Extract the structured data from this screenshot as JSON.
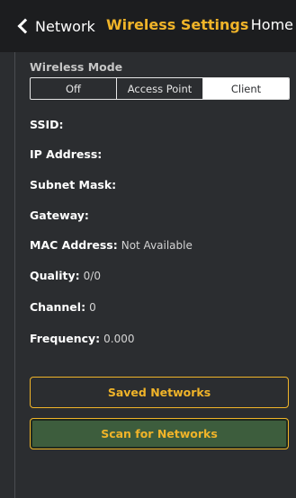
{
  "nav": {
    "back_label": "Network",
    "title": "Wireless Settings",
    "right_label": "Home"
  },
  "wireless_mode": {
    "label": "Wireless Mode",
    "options": [
      "Off",
      "Access Point",
      "Client"
    ],
    "selected": "Client"
  },
  "fields": [
    {
      "label": "SSID:",
      "value": ""
    },
    {
      "label": "IP Address:",
      "value": ""
    },
    {
      "label": "Subnet Mask:",
      "value": ""
    },
    {
      "label": "Gateway:",
      "value": ""
    },
    {
      "label": "MAC Address:",
      "value": "Not Available"
    },
    {
      "label": "Quality:",
      "value": "0/0"
    },
    {
      "label": "Channel:",
      "value": "0"
    },
    {
      "label": "Frequency:",
      "value": "0.000"
    }
  ],
  "buttons": {
    "saved_networks": "Saved Networks",
    "scan_networks": "Scan for Networks"
  },
  "colors": {
    "accent": "#f0b429",
    "background": "#2b2d30",
    "navbar": "#1c1d1f",
    "scan_button_bg": "#3d5d3d"
  },
  "icons": {
    "back": "chevron-left-icon"
  }
}
